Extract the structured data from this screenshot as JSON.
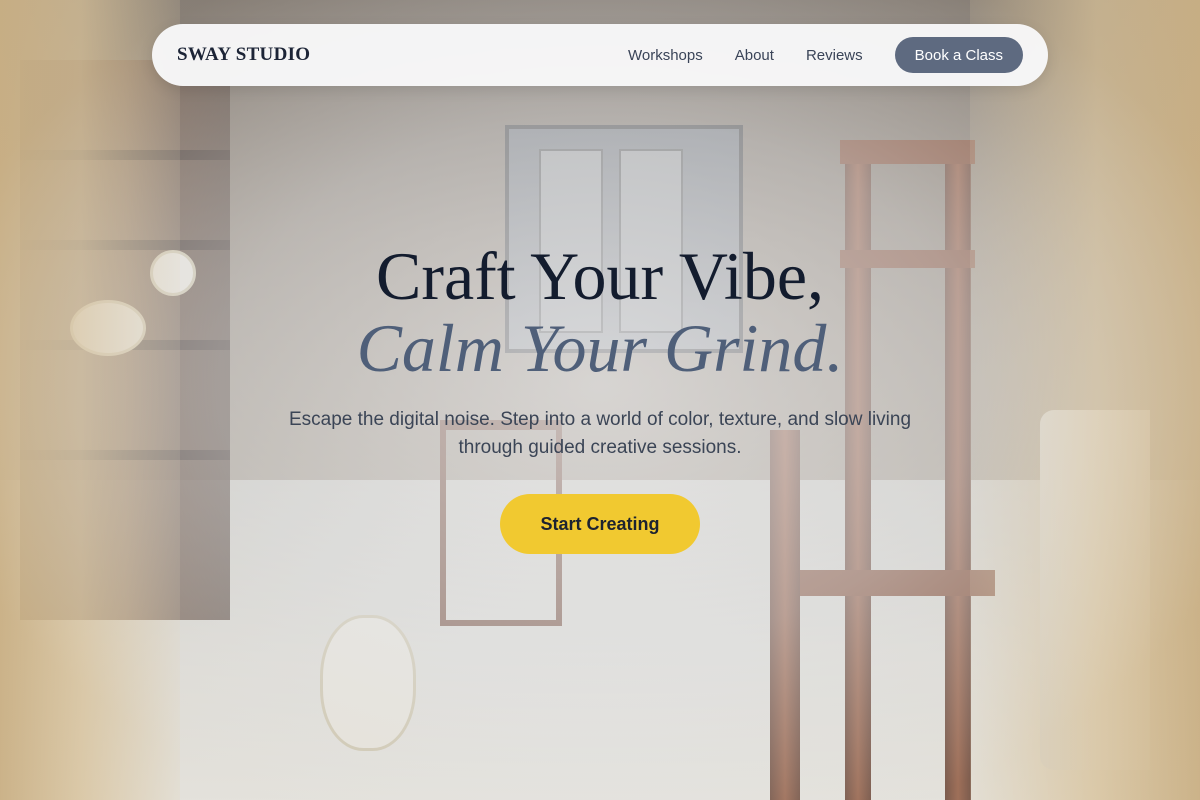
{
  "nav": {
    "brand": "SWAY STUDIO",
    "links": [
      "Workshops",
      "About",
      "Reviews"
    ],
    "cta_label": "Book a Class"
  },
  "hero": {
    "headline_line1": "Craft Your Vibe,",
    "headline_line2": "Calm Your Grind.",
    "subtitle": "Escape the digital noise. Step into a world of color, texture, and slow living through guided creative sessions.",
    "cta_label": "Start Creating"
  },
  "colors": {
    "brand_text": "#1c2436",
    "book_button": "#5e6a80",
    "cta_button": "#f1c930",
    "headline": "#131c2e",
    "headline_accent": "#4f5f79"
  }
}
